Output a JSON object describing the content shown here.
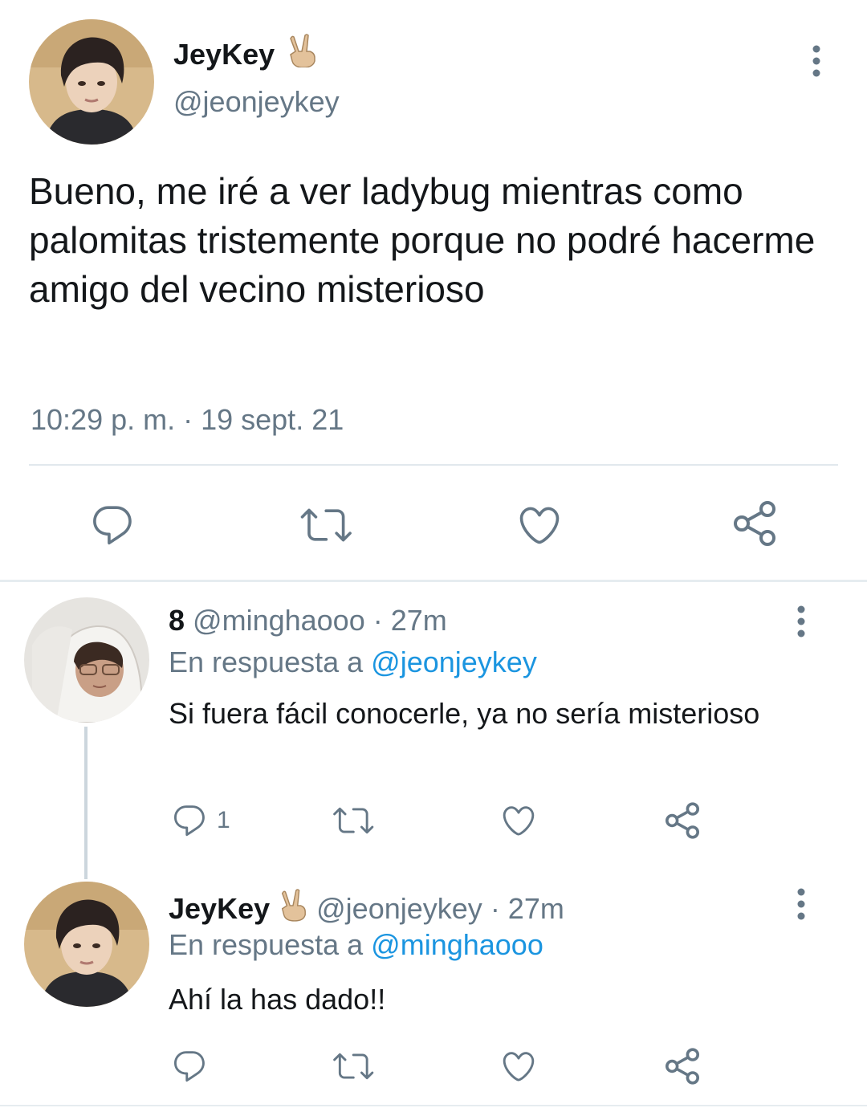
{
  "main_tweet": {
    "display_name": "JeyKey",
    "name_emoji": "✌🏼",
    "handle": "@jeonjeykey",
    "text": "Bueno, me iré a ver ladybug mientras como palomitas tristemente porque no podré hacerme amigo del vecino misterioso",
    "timestamp": "10:29 p. m. · 19 sept. 21"
  },
  "replies": [
    {
      "display_name": "8",
      "handle": "@minghaooo",
      "time": "· 27m",
      "reply_prefix": "En respuesta a",
      "reply_to": "@jeonjeykey",
      "text": "Si fuera fácil conocerle, ya no sería misterioso",
      "reply_count": "1"
    },
    {
      "display_name": "JeyKey",
      "name_emoji": "✌🏼",
      "handle": "@jeonjeykey",
      "time": "· 27m",
      "reply_prefix": "En respuesta a",
      "reply_to": "@minghaooo",
      "text": "Ahí la has dado!!",
      "reply_count": ""
    }
  ],
  "icons": [
    "reply-icon",
    "retweet-icon",
    "like-icon",
    "share-icon",
    "more-options-icon"
  ],
  "colors": {
    "text": "#14171a",
    "secondary": "#657786",
    "link": "#1b95e0",
    "divider": "#e1e8ed",
    "emoji_skin": "#e3c29b"
  }
}
